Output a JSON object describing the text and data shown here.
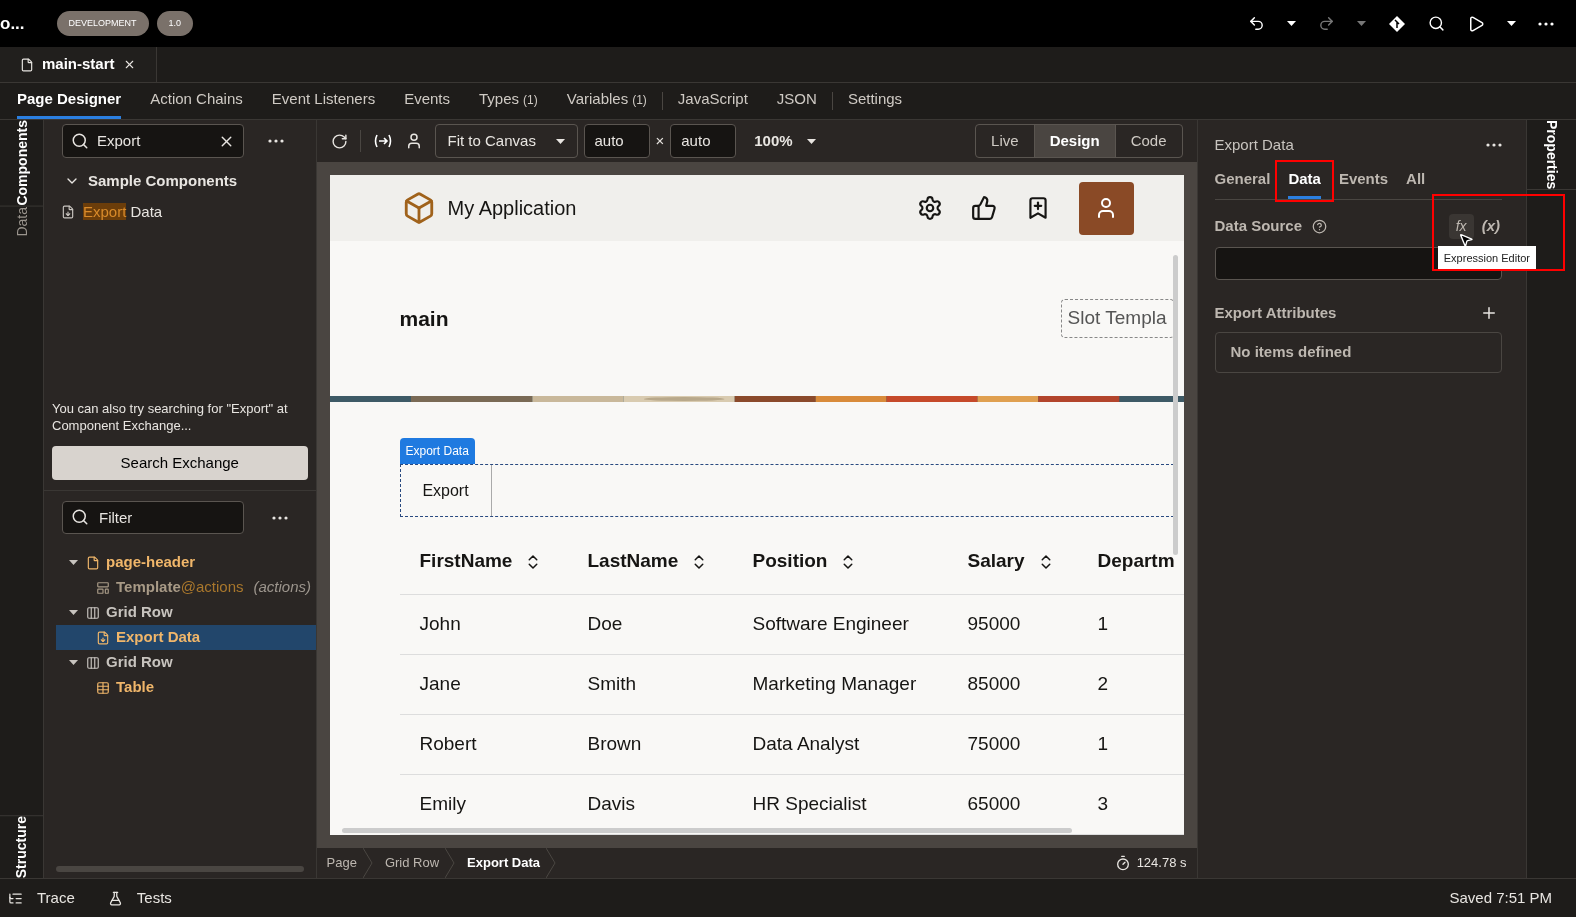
{
  "app": {
    "title_fragment": "o...",
    "badges": [
      "DEVELOPMENT",
      "1.0"
    ]
  },
  "file_tab": {
    "label": "main-start"
  },
  "nav_tabs": [
    {
      "label": "Page Designer",
      "selected": true
    },
    {
      "label": "Action Chains",
      "selected": false
    },
    {
      "label": "Event Listeners",
      "selected": false
    },
    {
      "label": "Events",
      "selected": false
    },
    {
      "label": "Types",
      "count": "(1)",
      "selected": false
    },
    {
      "label": "Variables",
      "count": "(1)",
      "selected": false
    },
    {
      "label": "JavaScript",
      "selected": false
    },
    {
      "label": "JSON",
      "selected": false
    },
    {
      "label": "Settings",
      "selected": false
    }
  ],
  "top_rail": [
    {
      "label": "Components",
      "selected": true
    },
    {
      "label": "Data",
      "selected": false
    }
  ],
  "bottom_rail": [
    {
      "label": "Structure",
      "selected": true
    }
  ],
  "components_panel": {
    "search_value": "Export",
    "group": {
      "label": "Sample Components",
      "expanded": true
    },
    "results": [
      {
        "match": "Export",
        "rest": " Data"
      }
    ],
    "hint": "You can also try searching for \"Export\" at Component Exchange...",
    "button": "Search Exchange"
  },
  "structure_panel": {
    "filter_placeholder": "Filter",
    "tree": [
      {
        "label": "page-header",
        "kind": "page",
        "expanded": true,
        "selected": false,
        "children": [
          {
            "label": "Template",
            "slot": "@actions",
            "note": "(actions)",
            "kind": "template",
            "selected": false
          }
        ]
      },
      {
        "label": "Grid Row",
        "kind": "grid",
        "expanded": true,
        "selected": false,
        "children": [
          {
            "label": "Export Data",
            "kind": "export",
            "selected": true
          }
        ]
      },
      {
        "label": "Grid Row",
        "kind": "grid",
        "expanded": true,
        "selected": false,
        "children": [
          {
            "label": "Table",
            "kind": "table",
            "selected": false
          }
        ]
      }
    ]
  },
  "canvas_toolbar": {
    "fit": "Fit to Canvas",
    "width": "auto",
    "times": "×",
    "height": "auto",
    "zoom": "100%",
    "modes": [
      {
        "label": "Live",
        "selected": false
      },
      {
        "label": "Design",
        "selected": true
      },
      {
        "label": "Code",
        "selected": false
      }
    ]
  },
  "page": {
    "app_title": "My Application",
    "heading": "main",
    "slot_label": "Slot Templa",
    "export_badge": "Export Data",
    "export_button": "Export",
    "table": {
      "columns": [
        "FirstName",
        "LastName",
        "Position",
        "Salary",
        "Departm"
      ],
      "rows": [
        [
          "John",
          "Doe",
          "Software Engineer",
          "95000",
          "1"
        ],
        [
          "Jane",
          "Smith",
          "Marketing Manager",
          "85000",
          "2"
        ],
        [
          "Robert",
          "Brown",
          "Data Analyst",
          "75000",
          "1"
        ],
        [
          "Emily",
          "Davis",
          "HR Specialist",
          "65000",
          "3"
        ]
      ]
    }
  },
  "breadcrumb": [
    {
      "label": "Page",
      "selected": false
    },
    {
      "label": "Grid Row",
      "selected": false
    },
    {
      "label": "Export Data",
      "selected": true
    }
  ],
  "timer": "124.78 s",
  "properties": {
    "title": "Export Data",
    "tabs": [
      {
        "label": "General",
        "selected": false,
        "annotated": false
      },
      {
        "label": "Data",
        "selected": true,
        "annotated": true
      },
      {
        "label": "Events",
        "selected": false,
        "annotated": false
      },
      {
        "label": "All",
        "selected": false,
        "annotated": false
      }
    ],
    "data_source_label": "Data Source",
    "fx": "fx",
    "variable": "(x)",
    "tooltip": "Expression Editor",
    "expression_annotated": true,
    "attributes_label": "Export Attributes",
    "empty": "No items defined"
  },
  "right_rail": {
    "label": "Properties"
  },
  "status": {
    "trace": "Trace",
    "tests": "Tests",
    "saved": "Saved 7:51 PM"
  }
}
